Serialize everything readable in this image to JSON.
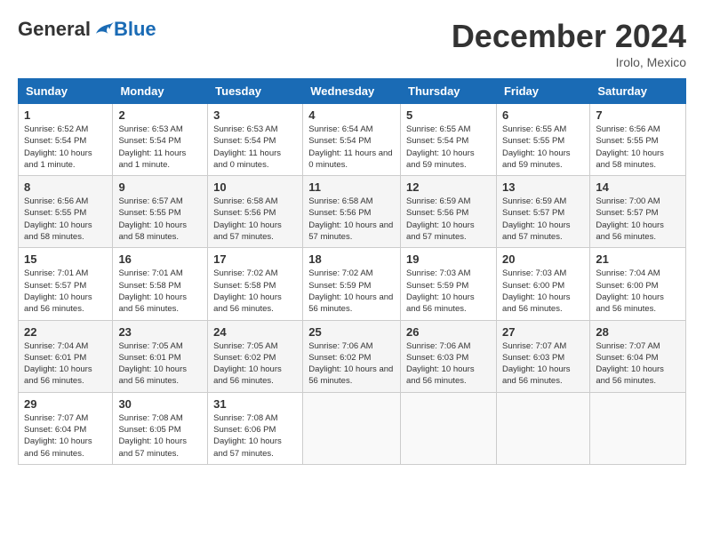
{
  "header": {
    "logo_general": "General",
    "logo_blue": "Blue",
    "month_title": "December 2024",
    "location": "Irolo, Mexico"
  },
  "weekdays": [
    "Sunday",
    "Monday",
    "Tuesday",
    "Wednesday",
    "Thursday",
    "Friday",
    "Saturday"
  ],
  "weeks": [
    [
      {
        "day": "1",
        "sunrise": "6:52 AM",
        "sunset": "5:54 PM",
        "daylight": "10 hours and 1 minute."
      },
      {
        "day": "2",
        "sunrise": "6:53 AM",
        "sunset": "5:54 PM",
        "daylight": "11 hours and 1 minute."
      },
      {
        "day": "3",
        "sunrise": "6:53 AM",
        "sunset": "5:54 PM",
        "daylight": "11 hours and 0 minutes."
      },
      {
        "day": "4",
        "sunrise": "6:54 AM",
        "sunset": "5:54 PM",
        "daylight": "11 hours and 0 minutes."
      },
      {
        "day": "5",
        "sunrise": "6:55 AM",
        "sunset": "5:54 PM",
        "daylight": "10 hours and 59 minutes."
      },
      {
        "day": "6",
        "sunrise": "6:55 AM",
        "sunset": "5:55 PM",
        "daylight": "10 hours and 59 minutes."
      },
      {
        "day": "7",
        "sunrise": "6:56 AM",
        "sunset": "5:55 PM",
        "daylight": "10 hours and 58 minutes."
      }
    ],
    [
      {
        "day": "8",
        "sunrise": "6:56 AM",
        "sunset": "5:55 PM",
        "daylight": "10 hours and 58 minutes."
      },
      {
        "day": "9",
        "sunrise": "6:57 AM",
        "sunset": "5:55 PM",
        "daylight": "10 hours and 58 minutes."
      },
      {
        "day": "10",
        "sunrise": "6:58 AM",
        "sunset": "5:56 PM",
        "daylight": "10 hours and 57 minutes."
      },
      {
        "day": "11",
        "sunrise": "6:58 AM",
        "sunset": "5:56 PM",
        "daylight": "10 hours and 57 minutes."
      },
      {
        "day": "12",
        "sunrise": "6:59 AM",
        "sunset": "5:56 PM",
        "daylight": "10 hours and 57 minutes."
      },
      {
        "day": "13",
        "sunrise": "6:59 AM",
        "sunset": "5:57 PM",
        "daylight": "10 hours and 57 minutes."
      },
      {
        "day": "14",
        "sunrise": "7:00 AM",
        "sunset": "5:57 PM",
        "daylight": "10 hours and 56 minutes."
      }
    ],
    [
      {
        "day": "15",
        "sunrise": "7:01 AM",
        "sunset": "5:57 PM",
        "daylight": "10 hours and 56 minutes."
      },
      {
        "day": "16",
        "sunrise": "7:01 AM",
        "sunset": "5:58 PM",
        "daylight": "10 hours and 56 minutes."
      },
      {
        "day": "17",
        "sunrise": "7:02 AM",
        "sunset": "5:58 PM",
        "daylight": "10 hours and 56 minutes."
      },
      {
        "day": "18",
        "sunrise": "7:02 AM",
        "sunset": "5:59 PM",
        "daylight": "10 hours and 56 minutes."
      },
      {
        "day": "19",
        "sunrise": "7:03 AM",
        "sunset": "5:59 PM",
        "daylight": "10 hours and 56 minutes."
      },
      {
        "day": "20",
        "sunrise": "7:03 AM",
        "sunset": "6:00 PM",
        "daylight": "10 hours and 56 minutes."
      },
      {
        "day": "21",
        "sunrise": "7:04 AM",
        "sunset": "6:00 PM",
        "daylight": "10 hours and 56 minutes."
      }
    ],
    [
      {
        "day": "22",
        "sunrise": "7:04 AM",
        "sunset": "6:01 PM",
        "daylight": "10 hours and 56 minutes."
      },
      {
        "day": "23",
        "sunrise": "7:05 AM",
        "sunset": "6:01 PM",
        "daylight": "10 hours and 56 minutes."
      },
      {
        "day": "24",
        "sunrise": "7:05 AM",
        "sunset": "6:02 PM",
        "daylight": "10 hours and 56 minutes."
      },
      {
        "day": "25",
        "sunrise": "7:06 AM",
        "sunset": "6:02 PM",
        "daylight": "10 hours and 56 minutes."
      },
      {
        "day": "26",
        "sunrise": "7:06 AM",
        "sunset": "6:03 PM",
        "daylight": "10 hours and 56 minutes."
      },
      {
        "day": "27",
        "sunrise": "7:07 AM",
        "sunset": "6:03 PM",
        "daylight": "10 hours and 56 minutes."
      },
      {
        "day": "28",
        "sunrise": "7:07 AM",
        "sunset": "6:04 PM",
        "daylight": "10 hours and 56 minutes."
      }
    ],
    [
      {
        "day": "29",
        "sunrise": "7:07 AM",
        "sunset": "6:04 PM",
        "daylight": "10 hours and 56 minutes."
      },
      {
        "day": "30",
        "sunrise": "7:08 AM",
        "sunset": "6:05 PM",
        "daylight": "10 hours and 57 minutes."
      },
      {
        "day": "31",
        "sunrise": "7:08 AM",
        "sunset": "6:06 PM",
        "daylight": "10 hours and 57 minutes."
      },
      null,
      null,
      null,
      null
    ]
  ]
}
